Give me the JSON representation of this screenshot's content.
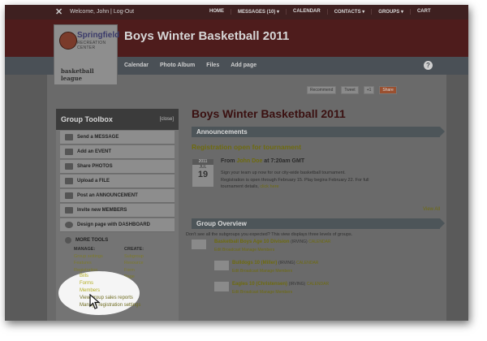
{
  "topbar": {
    "welcome": "Welcome, John | Log-Out",
    "nav": [
      "HOME",
      "MESSAGES (10) ▾",
      "CALENDAR",
      "CONTACTS ▾",
      "GROUPS ▾",
      "CART"
    ]
  },
  "header": {
    "title": "Boys Winter Basketball 2011"
  },
  "logo": {
    "brand": "Springfield",
    "sub": "RECREATION CENTER",
    "league": "basketball league"
  },
  "subnav": {
    "items": [
      "Calendar",
      "Photo Album",
      "Files",
      "Add page"
    ],
    "help": "?"
  },
  "social": [
    "Recommend",
    "Tweet",
    "+1",
    "Share"
  ],
  "toolbox": {
    "title": "Group Toolbox",
    "close": "[close]",
    "items": [
      "Send a MESSAGE",
      "Add an EVENT",
      "Share PHOTOS",
      "Upload a FILE",
      "Post an ANNOUNCEMENT",
      "Invite new MEMBERS",
      "Design page with DASHBOARD"
    ],
    "more_label": "MORE TOOLS",
    "manage_label": "MANAGE:",
    "create_label": "CREATE:",
    "manage": [
      "Group settings",
      "Features",
      "Registration",
      "Bills",
      "Forms",
      "Members"
    ],
    "create": [
      "Subgroup",
      "Resource",
      "Form",
      "Page"
    ],
    "extra": [
      "View group sales reports",
      "Manage registration settings"
    ]
  },
  "main": {
    "title": "Boys Winter Basketball 2011",
    "announcements_label": "Announcements",
    "announcement": {
      "heading": "Registration open for tournament",
      "date": {
        "year": "2011",
        "month": "JUL",
        "day": "19"
      },
      "from_prefix": "From",
      "author": "John Doe",
      "time": "at 7:20am GMT",
      "line1": "Sign your team up now for our city-wide basketball tournament.",
      "line2": "Registration is open through February 15. Play begins February 22. For full",
      "line3": "tournament details,",
      "link": "click here"
    },
    "view_all": "View All",
    "overview_label": "Group Overview",
    "overview_note": "Don't see all the subgroups you expected? This view displays three levels of groups.",
    "groups": [
      {
        "name": "Basketball Boys Age 10 Division",
        "location": "(IRVING)",
        "calendar": "CALENDAR",
        "actions": "Edit  Broadcast  Manage Members"
      },
      {
        "name": "Bulldogs 10 (Miller)",
        "location": "(IRVING)",
        "calendar": "CALENDAR",
        "actions": "Edit  Broadcast  Manage Members"
      },
      {
        "name": "Eagles 10 (Christensen)",
        "location": "(IRVING)",
        "calendar": "CALENDAR",
        "actions": "Edit  Broadcast  Manage Members"
      }
    ]
  },
  "colors": {
    "header": "#4e1c1c",
    "accent_link": "#b8b419",
    "title_red": "#3a1010"
  }
}
